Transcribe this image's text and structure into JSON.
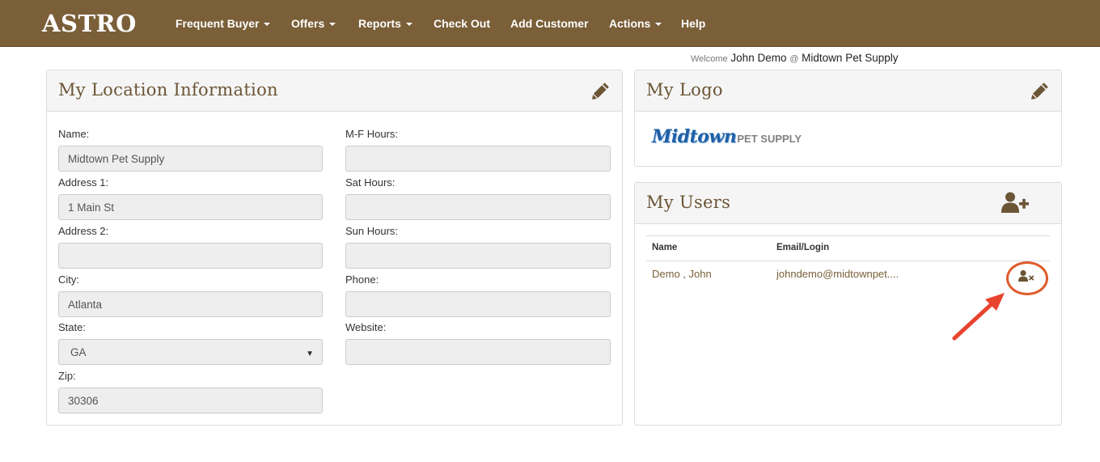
{
  "navbar": {
    "brand": "ASTRO",
    "items": [
      {
        "label": "Frequent Buyer",
        "dropdown": true
      },
      {
        "label": "Offers",
        "dropdown": true
      },
      {
        "label": "Reports",
        "dropdown": true
      },
      {
        "label": "Check Out",
        "dropdown": false
      },
      {
        "label": "Add Customer",
        "dropdown": false
      },
      {
        "label": "Actions",
        "dropdown": true
      },
      {
        "label": "Help",
        "dropdown": false
      }
    ]
  },
  "welcome": {
    "prefix": "Welcome",
    "user": "John Demo",
    "at": "@",
    "location": "Midtown Pet Supply"
  },
  "location_panel": {
    "title": "My Location Information",
    "edit_icon": "pencil-icon",
    "left_fields": [
      {
        "label": "Name:",
        "value": "Midtown Pet Supply"
      },
      {
        "label": "Address 1:",
        "value": "1 Main St"
      },
      {
        "label": "Address 2:",
        "value": ""
      },
      {
        "label": "City:",
        "value": "Atlanta"
      },
      {
        "label": "State:",
        "value": "GA"
      },
      {
        "label": "Zip:",
        "value": "30306"
      }
    ],
    "right_fields": [
      {
        "label": "M-F Hours:",
        "value": ""
      },
      {
        "label": "Sat Hours:",
        "value": ""
      },
      {
        "label": "Sun Hours:",
        "value": ""
      },
      {
        "label": "Phone:",
        "value": ""
      },
      {
        "label": "Website:",
        "value": ""
      }
    ]
  },
  "logo_panel": {
    "title": "My Logo",
    "edit_icon": "pencil-icon",
    "logo_text_main": "Midtown",
    "logo_text_sub": "PET SUPPLY"
  },
  "users_panel": {
    "title": "My Users",
    "add_icon": "user-plus-icon",
    "columns": [
      "Name",
      "Email/Login"
    ],
    "rows": [
      {
        "name": "Demo , John",
        "email": "johndemo@midtownpet....",
        "remove_icon": "user-remove-icon"
      }
    ]
  },
  "colors": {
    "navbar": "#7a5f38",
    "panel_title": "#6b5535",
    "highlight": "#e05a2b",
    "logo_blue": "#1f5fa6"
  }
}
